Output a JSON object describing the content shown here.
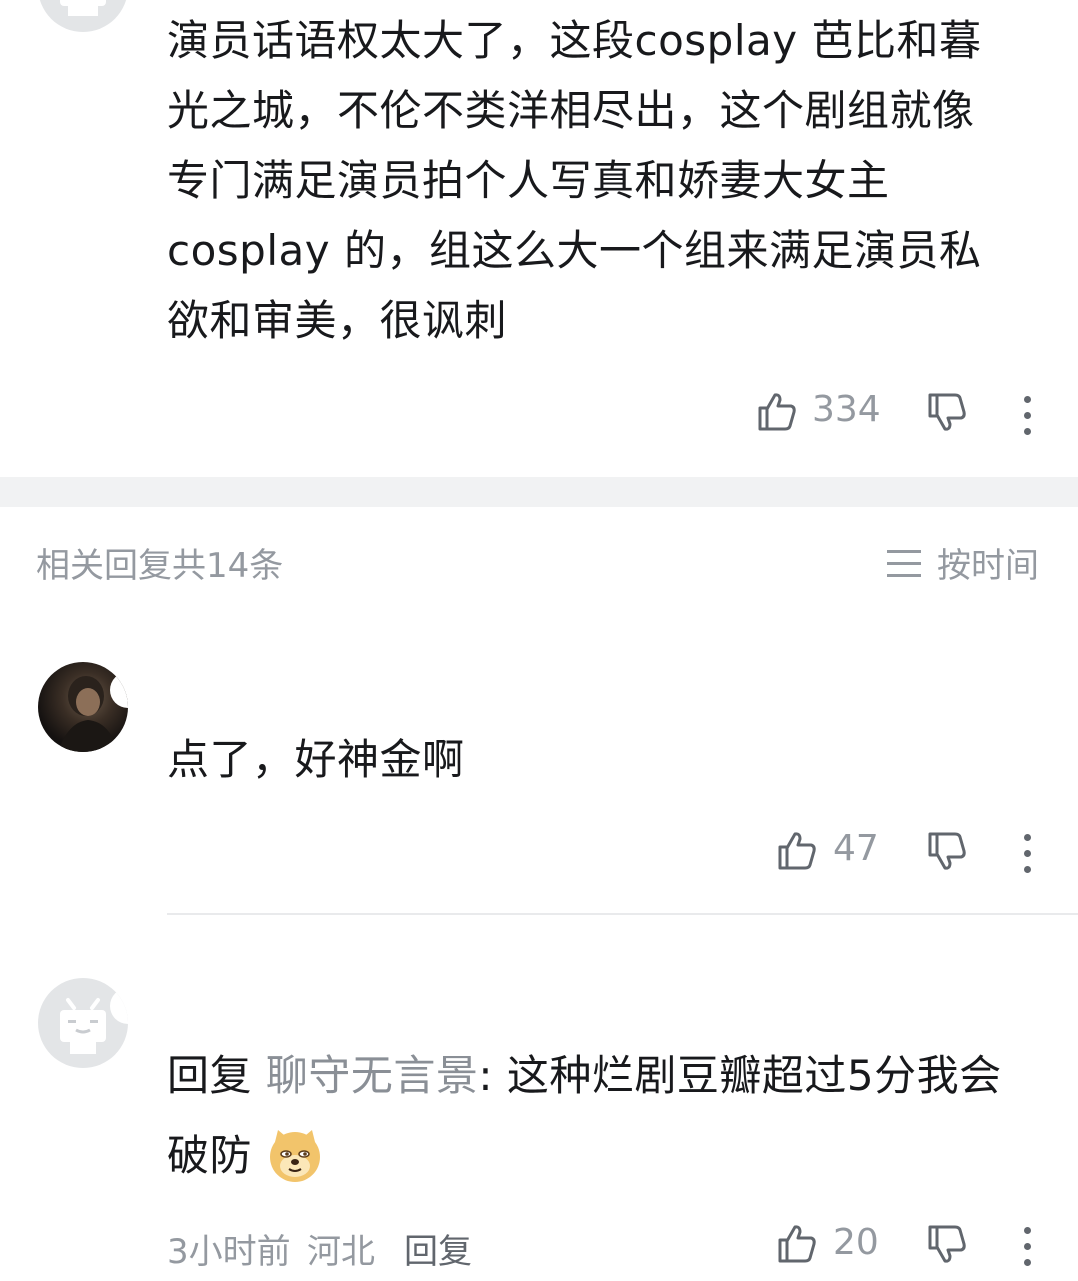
{
  "top_comment": {
    "text_lines": [
      "演员话语权太大了，这段cosplay 芭比和暮",
      "光之城，不伦不类洋相尽出，这个剧组就像",
      "专门满足演员拍个人写真和娇妻大女主",
      "cosplay 的，组这么大一个组来满足演员私",
      "欲和审美，很讽刺"
    ],
    "like_count": "334"
  },
  "replies_header": {
    "count_label": "相关回复共14条",
    "sort_label": "按时间"
  },
  "replies": [
    {
      "text": "点了，好神金啊",
      "like_count": "47"
    },
    {
      "reply_prefix": "回复",
      "mention": "聊守无言景",
      "separator": ":",
      "text_line1": " 这种烂剧豆瓣超过5分我会",
      "text_line2": "破防",
      "emoji": "doge-emoji",
      "time": "3小时前",
      "location": "河北",
      "reply_button": "回复",
      "like_count": "20"
    }
  ],
  "icons": [
    "thumbs-up-icon",
    "thumbs-down-icon",
    "more-icon",
    "sort-icon",
    "default-avatar-icon"
  ],
  "colors": {
    "text": "#18191c",
    "muted": "#9499a0",
    "band": "#f1f2f3"
  }
}
